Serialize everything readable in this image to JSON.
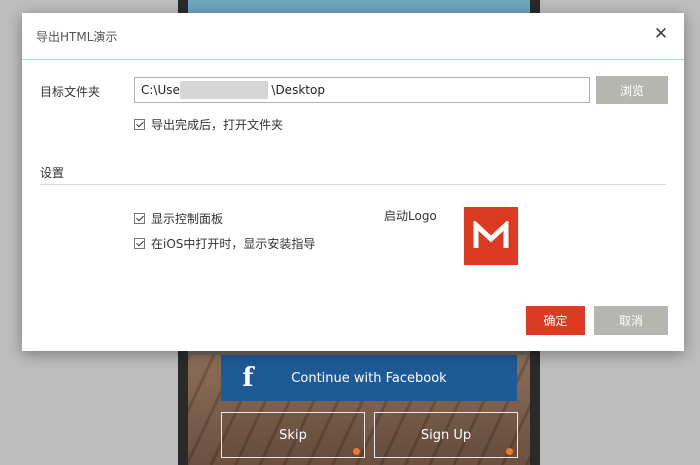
{
  "background": {
    "facebook_button": {
      "icon": "f",
      "label": "Continue with Facebook"
    },
    "skip_label": "Skip",
    "signup_label": "Sign Up"
  },
  "dialog": {
    "title": "导出HTML演示",
    "close_icon": "close-icon",
    "target_folder_label": "目标文件夹",
    "target_path": "C:\\Users\\                    \\Desktop",
    "browse_label": "浏览",
    "open_folder_after_export": {
      "label": "导出完成后，打开文件夹",
      "checked": true
    },
    "settings_heading": "设置",
    "show_control_panel": {
      "label": "显示控制面板",
      "checked": true
    },
    "ios_install_guide": {
      "label": "在iOS中打开时，显示安装指导",
      "checked": true
    },
    "launch_logo_label": "启动Logo",
    "ok_label": "确定",
    "cancel_label": "取消"
  },
  "colors": {
    "accent_red": "#dc3a21",
    "disabled_gray": "#b6b6b0",
    "facebook_blue": "#1e5b96",
    "header_rule": "#a8dcd8"
  }
}
